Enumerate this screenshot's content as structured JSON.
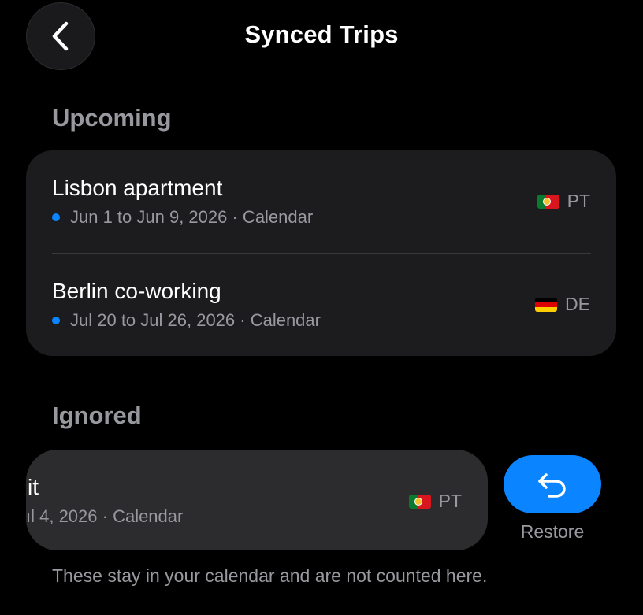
{
  "header": {
    "title": "Synced Trips",
    "back_icon": "chevron-left-icon"
  },
  "sections": {
    "upcoming": {
      "title": "Upcoming",
      "trips": [
        {
          "name": "Lisbon apartment",
          "dates": "Jun 1 to Jun 9, 2026 · Calendar",
          "country_code": "PT",
          "flag": "portugal-flag-icon"
        },
        {
          "name": "Berlin co-working",
          "dates": "Jul 20 to Jul 26, 2026 · Calendar",
          "country_code": "DE",
          "flag": "germany-flag-icon"
        }
      ]
    },
    "ignored": {
      "title": "Ignored",
      "trip": {
        "name_visible": "it",
        "dates_visible": "ıl 4, 2026 · Calendar",
        "country_code": "PT",
        "flag": "portugal-flag-icon"
      },
      "restore_label": "Restore",
      "restore_icon": "undo-arrow-icon"
    }
  },
  "footnote": "These stay in your calendar and are not counted here.",
  "colors": {
    "background": "#000000",
    "card": "#1c1c1e",
    "swiped_card": "#2c2c2e",
    "accent": "#0a84ff",
    "secondary_text": "#98989f"
  }
}
